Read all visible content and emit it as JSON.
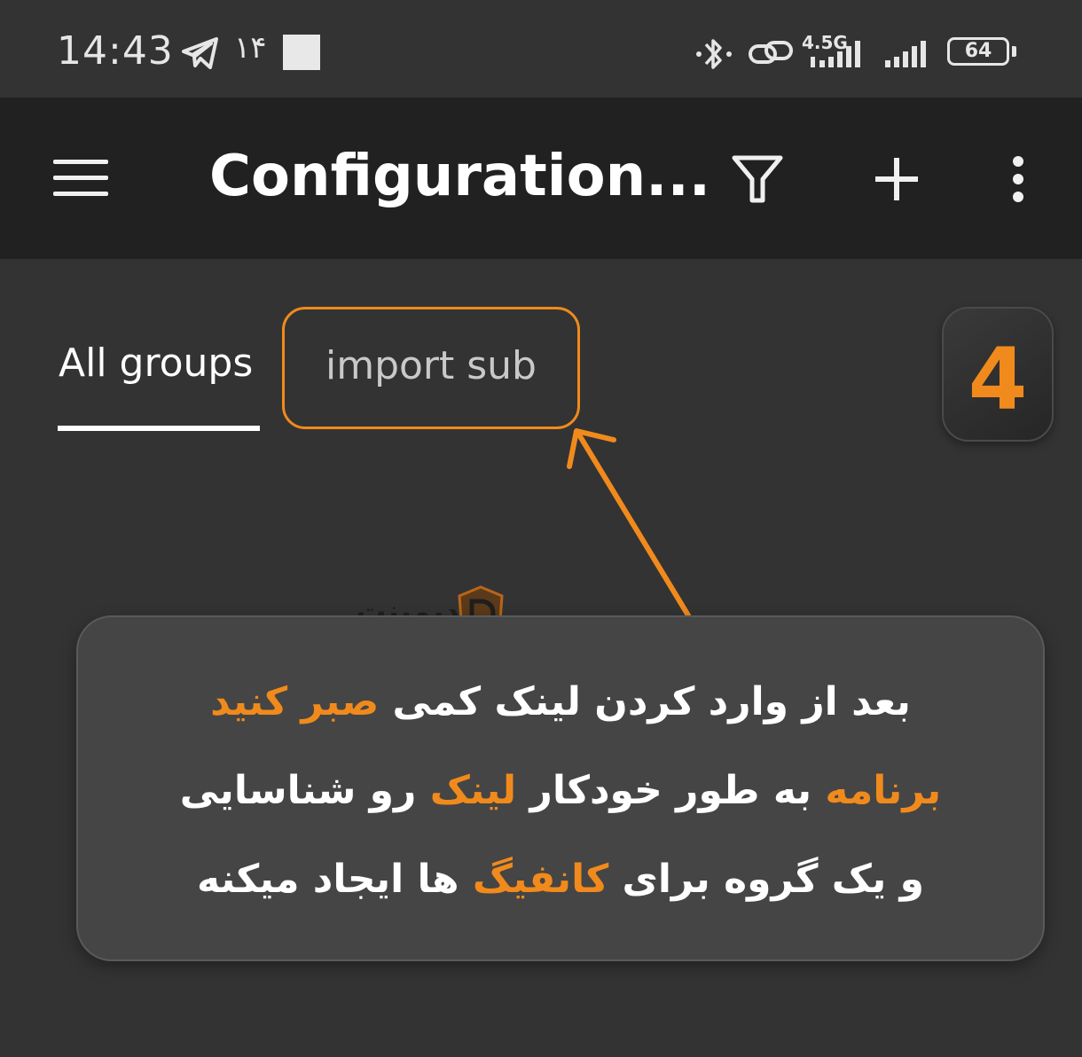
{
  "status_bar": {
    "time": "14:43",
    "notification_count": "۱۴",
    "network_label": "4.5G",
    "battery_level": "64",
    "icons": [
      "telegram-icon",
      "bluetooth-icon",
      "link-icon",
      "signal-icon",
      "battery-icon"
    ]
  },
  "app_bar": {
    "title": "Configuration...",
    "icons": [
      "menu-icon",
      "filter-icon",
      "add-icon",
      "more-vert-icon"
    ]
  },
  "tabs": [
    {
      "label": "All groups",
      "selected": true
    },
    {
      "label": "import sub",
      "selected": false
    }
  ],
  "step_badge": {
    "number": "4"
  },
  "watermark": {
    "text": "دیمینت"
  },
  "info_card": {
    "line1": {
      "plain": "بعد از وارد کردن لینک کمی ",
      "highlight": "صبر کنید"
    },
    "line2": {
      "highlight1": "برنامه",
      "plain1": " به طور خودکار ",
      "highlight2": "لینک",
      "plain2": " رو شناسایی"
    },
    "line3": {
      "plain1": "و یک گروه برای ",
      "highlight": "کانفیگ",
      "plain2": " ها ایجاد میکنه"
    }
  },
  "colors": {
    "accent": "#f18a1c",
    "background": "#333333",
    "app_bar": "#212121",
    "card": "#454545"
  }
}
